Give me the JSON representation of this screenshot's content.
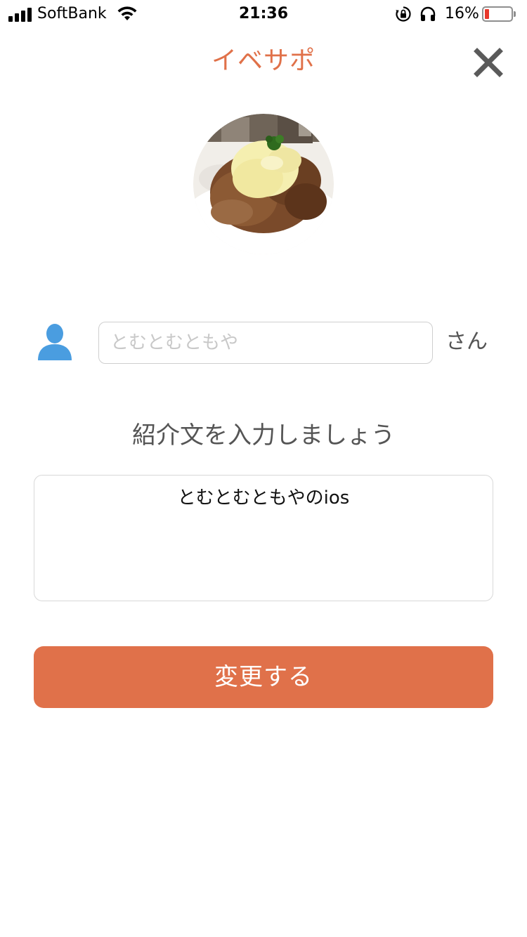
{
  "status_bar": {
    "carrier": "SoftBank",
    "time": "21:36",
    "battery_percent": "16%",
    "battery_level": 0.16,
    "icons": [
      "signal-icon",
      "wifi-icon",
      "orientation-lock-icon",
      "headphone-icon",
      "battery-icon"
    ]
  },
  "header": {
    "title": "イベサポ",
    "close_icon": "close-icon"
  },
  "profile": {
    "avatar": "avatar-food-photo",
    "name_field": {
      "icon": "user-icon",
      "value": "",
      "placeholder": "とむとむともや",
      "suffix": "さん"
    },
    "intro": {
      "label": "紹介文を入力しましょう",
      "value": "とむとむともやのios"
    },
    "submit_label": "変更する"
  },
  "colors": {
    "accent": "#e0714a",
    "title": "#e07149",
    "user_icon": "#4a9de0",
    "close_icon": "#5a5a5a",
    "battery_low": "#e8382c"
  }
}
